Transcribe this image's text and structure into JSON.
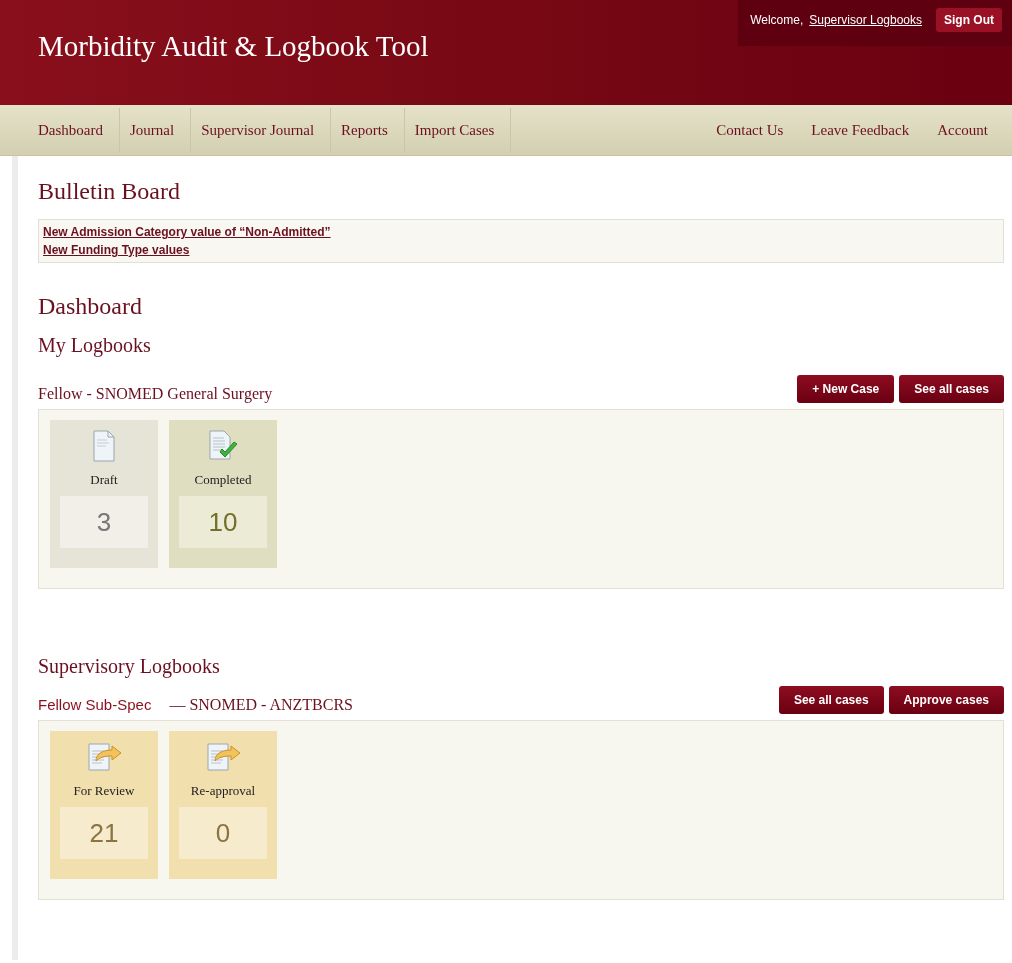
{
  "header": {
    "title": "Morbidity Audit & Logbook Tool",
    "welcome": "Welcome,",
    "user": "Supervisor Logbooks",
    "sign_out": "Sign Out"
  },
  "nav": {
    "left": [
      {
        "label": "Dashboard"
      },
      {
        "label": "Journal"
      },
      {
        "label": "Supervisor Journal"
      },
      {
        "label": "Reports"
      },
      {
        "label": "Import Cases"
      }
    ],
    "right": [
      {
        "label": "Contact Us"
      },
      {
        "label": "Leave Feedback"
      },
      {
        "label": "Account"
      }
    ]
  },
  "bulletin": {
    "title": "Bulletin Board",
    "links": [
      "New Admission Category value of “Non-Admitted”",
      "New Funding Type values"
    ]
  },
  "dashboard_title": "Dashboard",
  "sections": [
    {
      "title": "My Logbooks",
      "logbook": {
        "title": "Fellow - SNOMED General Surgery",
        "buttons": [
          "+ New Case",
          "See all cases"
        ],
        "tiles": [
          {
            "kind": "draft",
            "label": "Draft",
            "count": "3"
          },
          {
            "kind": "completed",
            "label": "Completed",
            "count": "10"
          }
        ]
      }
    },
    {
      "title": "Supervisory Logbooks",
      "logbook": {
        "role": "Fellow Sub-Spec",
        "title": "— SNOMED - ANZTBCRS",
        "buttons": [
          "See all cases",
          "Approve cases"
        ],
        "tiles": [
          {
            "kind": "review",
            "label": "For Review",
            "count": "21"
          },
          {
            "kind": "review",
            "label": "Re-approval",
            "count": "0"
          }
        ]
      }
    }
  ]
}
